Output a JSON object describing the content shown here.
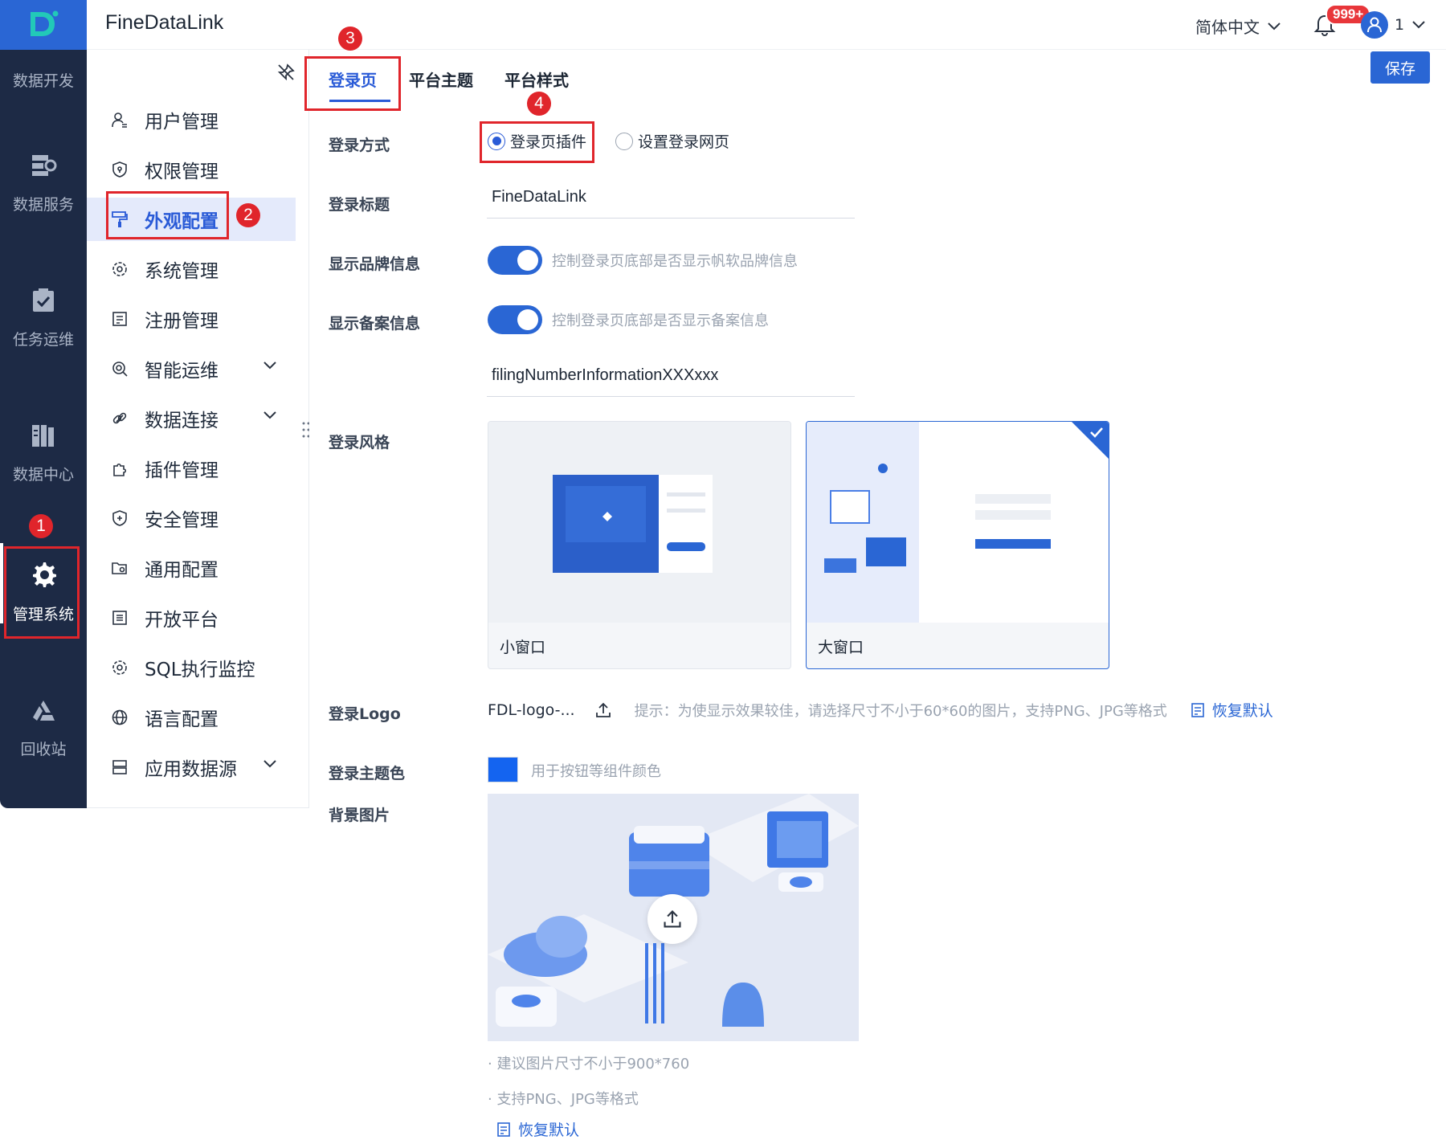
{
  "app": {
    "title": "FineDataLink"
  },
  "header": {
    "language": "简体中文",
    "notification_count": "999+",
    "user": "1"
  },
  "left_nav": {
    "items": [
      {
        "label": "数据开发",
        "icon": "data-dev-icon"
      },
      {
        "label": "数据服务",
        "icon": "data-service-icon"
      },
      {
        "label": "任务运维",
        "icon": "task-ops-icon"
      },
      {
        "label": "数据中心",
        "icon": "data-center-icon"
      },
      {
        "label": "管理系统",
        "icon": "gear-icon",
        "active": true
      },
      {
        "label": "回收站",
        "icon": "recycle-icon"
      }
    ]
  },
  "sub_menu": {
    "items": [
      {
        "label": "用户管理",
        "icon": "user-icon"
      },
      {
        "label": "权限管理",
        "icon": "permission-icon"
      },
      {
        "label": "外观配置",
        "icon": "paint-roller-icon",
        "active": true
      },
      {
        "label": "系统管理",
        "icon": "settings-icon"
      },
      {
        "label": "注册管理",
        "icon": "register-icon"
      },
      {
        "label": "智能运维",
        "icon": "smart-ops-icon",
        "expandable": true
      },
      {
        "label": "数据连接",
        "icon": "link-icon",
        "expandable": true
      },
      {
        "label": "插件管理",
        "icon": "plugin-icon"
      },
      {
        "label": "安全管理",
        "icon": "shield-icon"
      },
      {
        "label": "通用配置",
        "icon": "folder-gear-icon"
      },
      {
        "label": "开放平台",
        "icon": "open-platform-icon"
      },
      {
        "label": "SQL执行监控",
        "icon": "sql-monitor-icon"
      },
      {
        "label": "语言配置",
        "icon": "globe-icon"
      },
      {
        "label": "应用数据源",
        "icon": "database-icon",
        "expandable": true
      }
    ]
  },
  "tabs": [
    {
      "label": "登录页",
      "active": true
    },
    {
      "label": "平台主题"
    },
    {
      "label": "平台样式"
    }
  ],
  "toolbar": {
    "save_label": "保存"
  },
  "form": {
    "login_method": {
      "label": "登录方式",
      "options": [
        {
          "label": "登录页插件",
          "checked": true
        },
        {
          "label": "设置登录网页",
          "checked": false
        }
      ]
    },
    "login_title": {
      "label": "登录标题",
      "value": "FineDataLink"
    },
    "show_brand": {
      "label": "显示品牌信息",
      "enabled": true,
      "hint": "控制登录页底部是否显示帆软品牌信息"
    },
    "show_filing": {
      "label": "显示备案信息",
      "enabled": true,
      "hint": "控制登录页底部是否显示备案信息",
      "value": "filingNumberInformationXXXxxx"
    },
    "login_style": {
      "label": "登录风格",
      "options": [
        {
          "label": "小窗口",
          "selected": false
        },
        {
          "label": "大窗口",
          "selected": true
        }
      ]
    },
    "login_logo": {
      "label": "登录Logo",
      "file": "FDL-logo-...",
      "hint": "提示：为使显示效果较佳，请选择尺寸不小于60*60的图片，支持PNG、JPG等格式",
      "reset": "恢复默认"
    },
    "theme_color": {
      "label": "登录主题色",
      "color": "#1464f0",
      "hint": "用于按钮等组件颜色"
    },
    "background": {
      "label": "背景图片",
      "notes": [
        "· 建议图片尺寸不小于900*760",
        "· 支持PNG、JPG等格式"
      ],
      "reset": "恢复默认"
    }
  },
  "annotations": [
    "1",
    "2",
    "3",
    "4"
  ],
  "colors": {
    "accent": "#2a66d4",
    "nav_bg": "#1d2a45",
    "annotation": "#e0252b"
  }
}
